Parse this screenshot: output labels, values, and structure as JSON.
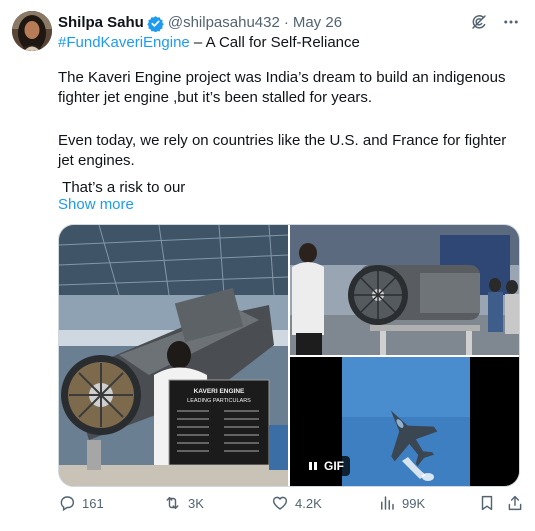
{
  "author": {
    "name": "Shilpa Sahu",
    "handle": "@shilpasahu432",
    "separator": "·",
    "date": "May 26",
    "verified_color": "#1d9bf0"
  },
  "icons": {
    "verified": "verified-badge-icon",
    "grok": "grok-icon",
    "more": "more-options-icon",
    "reply": "reply-icon",
    "retweet": "retweet-icon",
    "like": "heart-icon",
    "views": "views-chart-icon",
    "bookmark": "bookmark-icon",
    "share": "share-icon"
  },
  "tweet": {
    "hashtag": "#FundKaveriEngine",
    "headline_rest": " – A Call for Self-Reliance",
    "paragraph1": "The Kaveri Engine project was India’s dream to build an indigenous fighter jet engine ,but it’s been stalled for years.",
    "paragraph2": "Even today, we rely on countries like the U.S. and France for fighter jet engines.",
    "paragraph3": " That’s a risk to our",
    "show_more": "Show more",
    "link_color": "#1d9bf0"
  },
  "media": {
    "placard_title": "KAVERI ENGINE",
    "placard_subtitle": "LEADING PARTICULARS",
    "gif_label": "GIF"
  },
  "stats": {
    "replies": "161",
    "retweets": "3K",
    "likes": "4.2K",
    "views": "99K"
  }
}
